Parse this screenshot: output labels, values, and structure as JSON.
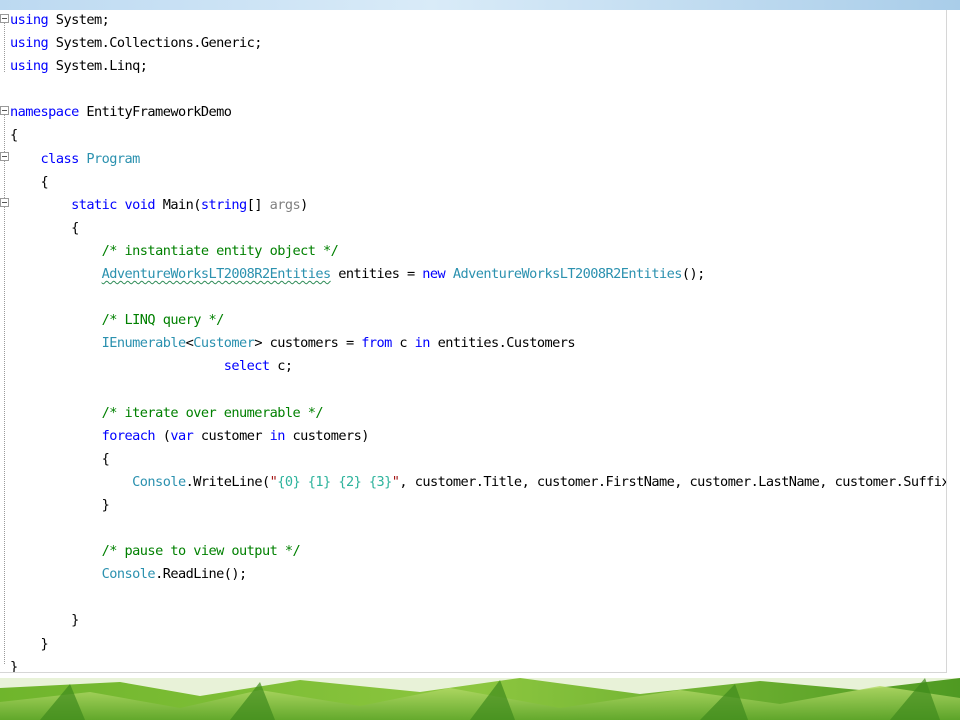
{
  "editor": {
    "lines": [
      [
        {
          "t": "using",
          "c": "kw"
        },
        {
          "t": " System;",
          "c": ""
        }
      ],
      [
        {
          "t": "using",
          "c": "kw"
        },
        {
          "t": " System.Collections.Generic;",
          "c": ""
        }
      ],
      [
        {
          "t": "using",
          "c": "kw"
        },
        {
          "t": " System.Linq;",
          "c": ""
        }
      ],
      [],
      [
        {
          "t": "namespace",
          "c": "kw"
        },
        {
          "t": " EntityFrameworkDemo",
          "c": ""
        }
      ],
      [
        {
          "t": "{",
          "c": ""
        }
      ],
      [
        {
          "t": "    ",
          "c": ""
        },
        {
          "t": "class",
          "c": "kw"
        },
        {
          "t": " ",
          "c": ""
        },
        {
          "t": "Program",
          "c": "ty"
        }
      ],
      [
        {
          "t": "    {",
          "c": ""
        }
      ],
      [
        {
          "t": "        ",
          "c": ""
        },
        {
          "t": "static",
          "c": "kw"
        },
        {
          "t": " ",
          "c": ""
        },
        {
          "t": "void",
          "c": "kw"
        },
        {
          "t": " Main(",
          "c": ""
        },
        {
          "t": "string",
          "c": "kw"
        },
        {
          "t": "[] ",
          "c": ""
        },
        {
          "t": "args",
          "c": "pa"
        },
        {
          "t": ")",
          "c": ""
        }
      ],
      [
        {
          "t": "        {",
          "c": ""
        }
      ],
      [
        {
          "t": "            ",
          "c": ""
        },
        {
          "t": "/* instantiate entity object */",
          "c": "cm"
        }
      ],
      [
        {
          "t": "            ",
          "c": ""
        },
        {
          "t": "AdventureWorksLT2008R2Entities",
          "c": "ty squiggle"
        },
        {
          "t": " entities = ",
          "c": ""
        },
        {
          "t": "new",
          "c": "kw"
        },
        {
          "t": " ",
          "c": ""
        },
        {
          "t": "AdventureWorksLT2008R2Entities",
          "c": "ty"
        },
        {
          "t": "();",
          "c": ""
        }
      ],
      [],
      [
        {
          "t": "            ",
          "c": ""
        },
        {
          "t": "/* LINQ query */",
          "c": "cm"
        }
      ],
      [
        {
          "t": "            ",
          "c": ""
        },
        {
          "t": "IEnumerable",
          "c": "ty"
        },
        {
          "t": "<",
          "c": ""
        },
        {
          "t": "Customer",
          "c": "ty"
        },
        {
          "t": "> customers = ",
          "c": ""
        },
        {
          "t": "from",
          "c": "kw"
        },
        {
          "t": " c ",
          "c": ""
        },
        {
          "t": "in",
          "c": "kw"
        },
        {
          "t": " entities.Customers",
          "c": ""
        }
      ],
      [
        {
          "t": "                            ",
          "c": ""
        },
        {
          "t": "select",
          "c": "kw"
        },
        {
          "t": " c;",
          "c": ""
        }
      ],
      [],
      [
        {
          "t": "            ",
          "c": ""
        },
        {
          "t": "/* iterate over enumerable */",
          "c": "cm"
        }
      ],
      [
        {
          "t": "            ",
          "c": ""
        },
        {
          "t": "foreach",
          "c": "kw"
        },
        {
          "t": " (",
          "c": ""
        },
        {
          "t": "var",
          "c": "kw"
        },
        {
          "t": " customer ",
          "c": ""
        },
        {
          "t": "in",
          "c": "kw"
        },
        {
          "t": " customers)",
          "c": ""
        }
      ],
      [
        {
          "t": "            {",
          "c": ""
        }
      ],
      [
        {
          "t": "                ",
          "c": ""
        },
        {
          "t": "Console",
          "c": "ty"
        },
        {
          "t": ".WriteLine(",
          "c": ""
        },
        {
          "t": "\"",
          "c": "st"
        },
        {
          "t": "{0}",
          "c": "es"
        },
        {
          "t": " ",
          "c": "st"
        },
        {
          "t": "{1}",
          "c": "es"
        },
        {
          "t": " ",
          "c": "st"
        },
        {
          "t": "{2}",
          "c": "es"
        },
        {
          "t": " ",
          "c": "st"
        },
        {
          "t": "{3}",
          "c": "es"
        },
        {
          "t": "\"",
          "c": "st"
        },
        {
          "t": ", customer.Title, customer.FirstName, customer.LastName, customer.Suffix);",
          "c": ""
        }
      ],
      [
        {
          "t": "            }",
          "c": ""
        }
      ],
      [],
      [
        {
          "t": "            ",
          "c": ""
        },
        {
          "t": "/* pause to view output */",
          "c": "cm"
        }
      ],
      [
        {
          "t": "            ",
          "c": ""
        },
        {
          "t": "Console",
          "c": "ty"
        },
        {
          "t": ".ReadLine();",
          "c": ""
        }
      ],
      [],
      [
        {
          "t": "        }",
          "c": ""
        }
      ],
      [
        {
          "t": "    }",
          "c": ""
        }
      ],
      [
        {
          "t": "}",
          "c": ""
        }
      ]
    ]
  },
  "colors": {
    "keyword": "#0000ff",
    "type": "#2b91af",
    "comment": "#008000",
    "string": "#a31515",
    "format_placeholder": "#2db39c",
    "unused_parameter": "#808080"
  },
  "icons": [
    "collapse-minus-icon",
    "grass-decoration"
  ]
}
